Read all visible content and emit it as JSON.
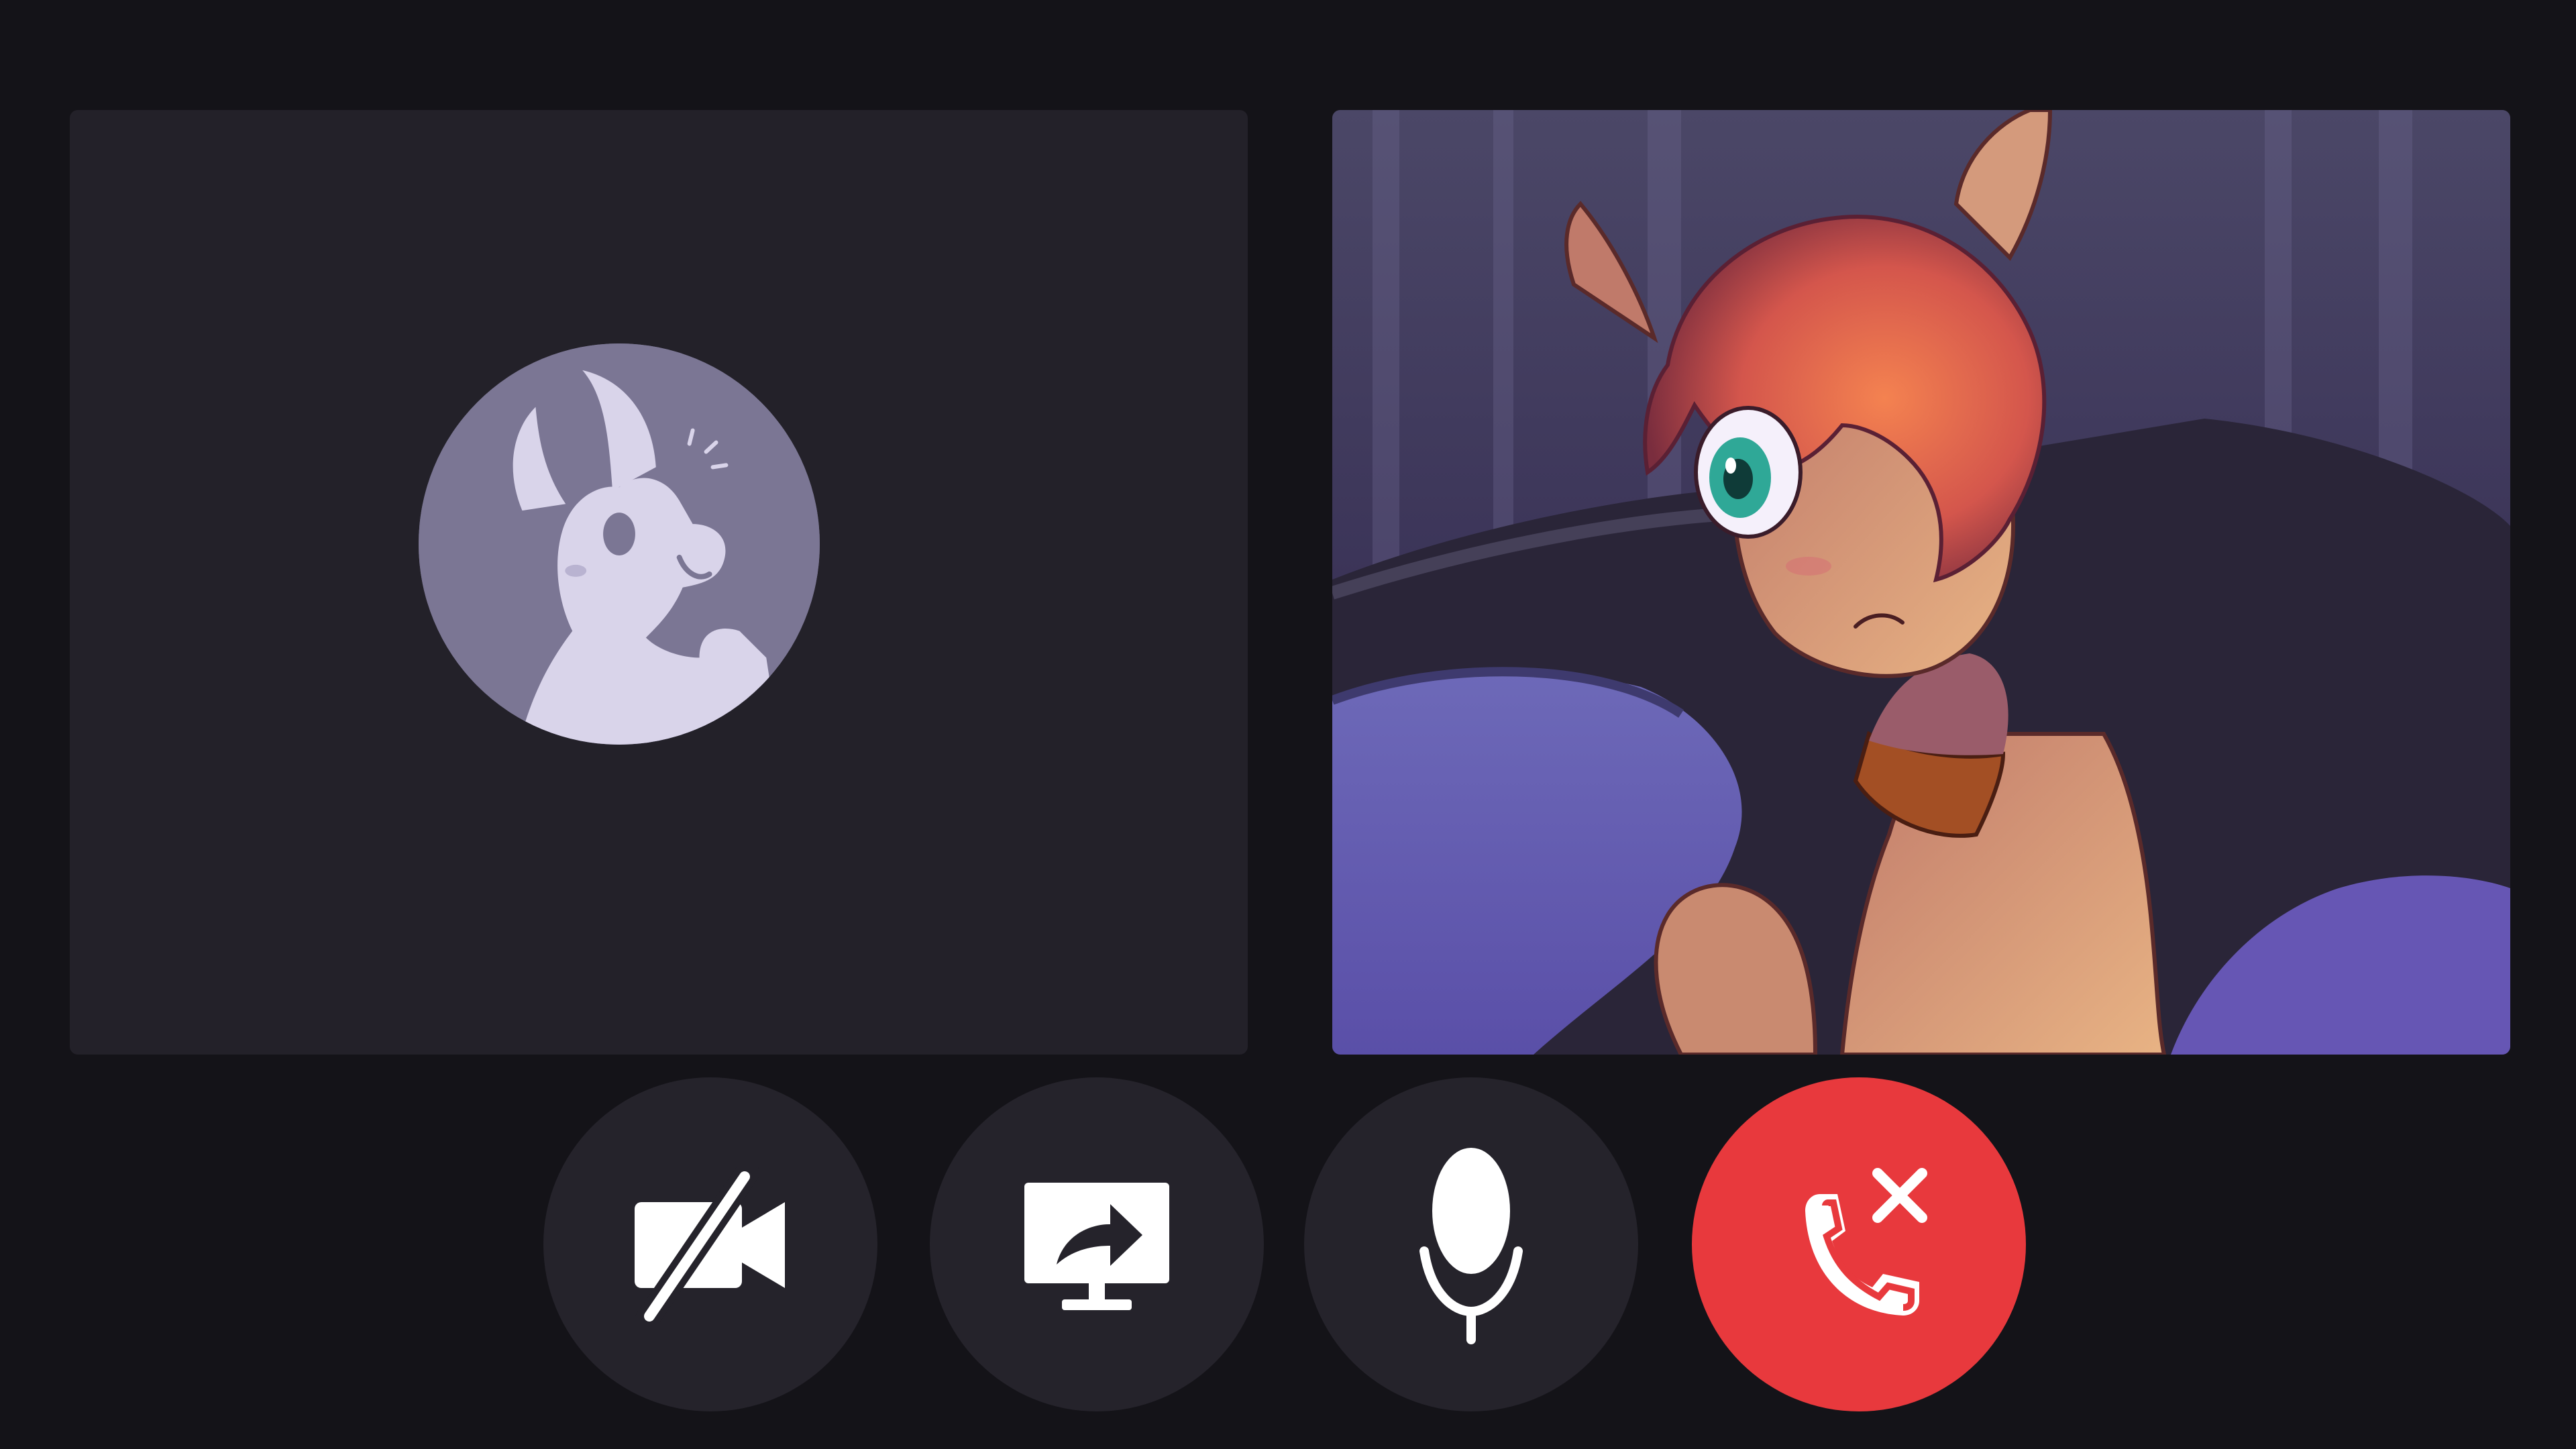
{
  "window": {
    "background": "#141318"
  },
  "participants": [
    {
      "tile": "left",
      "video": "off",
      "avatar_icon": "pony-silhouette-avatar-icon",
      "avatar_color": "#7b7694",
      "tile_color": "#232129"
    },
    {
      "tile": "right",
      "video": "on",
      "feed_icon": "pony-video-feed-image"
    }
  ],
  "controls": [
    {
      "id": "camera",
      "icon": "camera-off-icon",
      "state": "disabled",
      "color": "#25232b"
    },
    {
      "id": "share",
      "icon": "screen-share-icon",
      "color": "#25232b"
    },
    {
      "id": "mic",
      "icon": "microphone-icon",
      "state": "enabled",
      "color": "#25232b"
    },
    {
      "id": "hangup",
      "icon": "hang-up-icon",
      "color": "#e8393d"
    }
  ],
  "colors": {
    "accent_hangup": "#e8393d",
    "control_bg": "#25232b",
    "icon_fg": "#ffffff"
  }
}
